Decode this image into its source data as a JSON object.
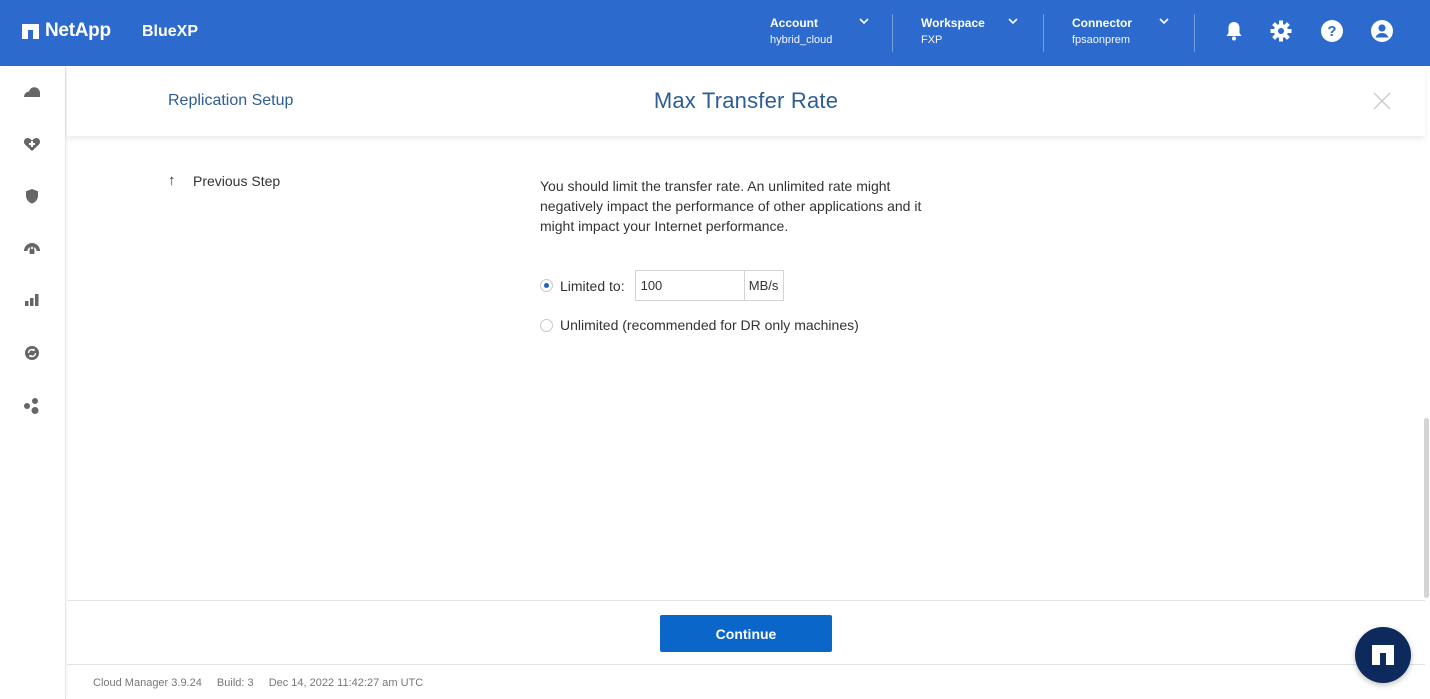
{
  "topbar": {
    "brand": "NetApp",
    "product": "BlueXP",
    "account": {
      "label": "Account",
      "value": "hybrid_cloud"
    },
    "workspace": {
      "label": "Workspace",
      "value": "FXP"
    },
    "connector": {
      "label": "Connector",
      "value": "fpsaonprem"
    },
    "icons": [
      "bell-icon",
      "gear-icon",
      "help-icon",
      "user-icon"
    ],
    "color": "#2c6bcd"
  },
  "sidebar": {
    "items": [
      {
        "icon": "storage-cloud-icon"
      },
      {
        "icon": "health-icon"
      },
      {
        "icon": "protection-shield-icon"
      },
      {
        "icon": "governance-icon"
      },
      {
        "icon": "analytics-icon"
      },
      {
        "icon": "sync-icon"
      },
      {
        "icon": "extensions-icon"
      }
    ]
  },
  "header": {
    "breadcrumb": "Replication Setup",
    "title": "Max Transfer Rate"
  },
  "wizard": {
    "previous_step": "Previous Step",
    "description": "You should limit the transfer rate. An unlimited rate might negatively impact the performance of other applications and it might impact your Internet performance.",
    "options": [
      {
        "label": "Limited to:",
        "selected": true
      },
      {
        "label": "Unlimited (recommended for DR only machines)",
        "selected": false
      }
    ],
    "rate_value": "100",
    "rate_unit": "MB/s",
    "continue_label": "Continue"
  },
  "status_bar": {
    "version": "Cloud Manager 3.9.24",
    "build": "Build: 3",
    "timestamp": "Dec 14, 2022 11:42:27 am UTC"
  },
  "colors": {
    "primary_button": "#0a67c9",
    "title_text": "#2e5d96",
    "fab": "#0e2a5c"
  }
}
